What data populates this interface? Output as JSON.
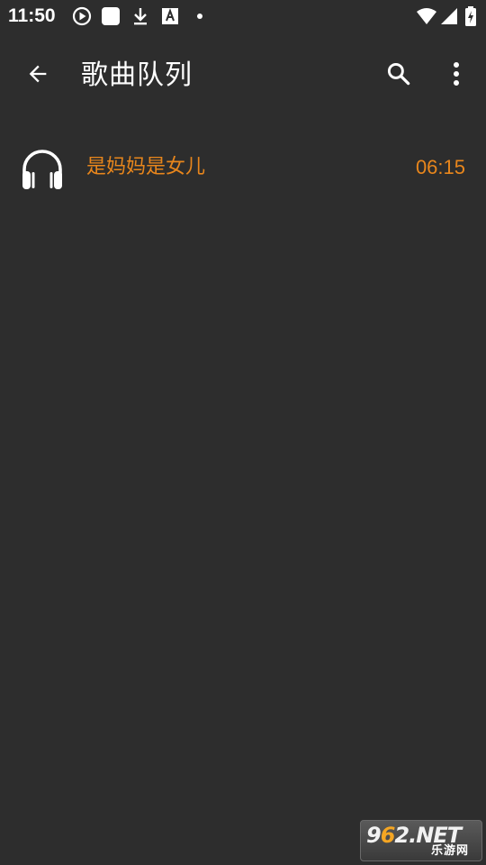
{
  "status_bar": {
    "time": "11:50",
    "icons_left": [
      "play-circle-icon",
      "square-notification-icon",
      "download-icon",
      "translate-a-icon",
      "dot-icon"
    ],
    "icons_right": [
      "wifi-icon",
      "cellular-signal-icon",
      "battery-charging-icon"
    ]
  },
  "app_bar": {
    "title": "歌曲队列",
    "back_icon": "arrow-back-icon",
    "search_icon": "search-icon",
    "more_icon": "more-vert-icon"
  },
  "queue": [
    {
      "icon": "headphones-icon",
      "title": "是妈妈是女儿",
      "duration": "06:15"
    }
  ],
  "watermark": {
    "brand_digits_a": "9",
    "brand_digits_b": "6",
    "brand_digits_c": "2",
    "brand_suffix": ".NET",
    "sub_text": "乐游网"
  },
  "colors": {
    "background": "#2d2d2d",
    "accent": "#e8861c",
    "text_primary": "#ffffff"
  }
}
